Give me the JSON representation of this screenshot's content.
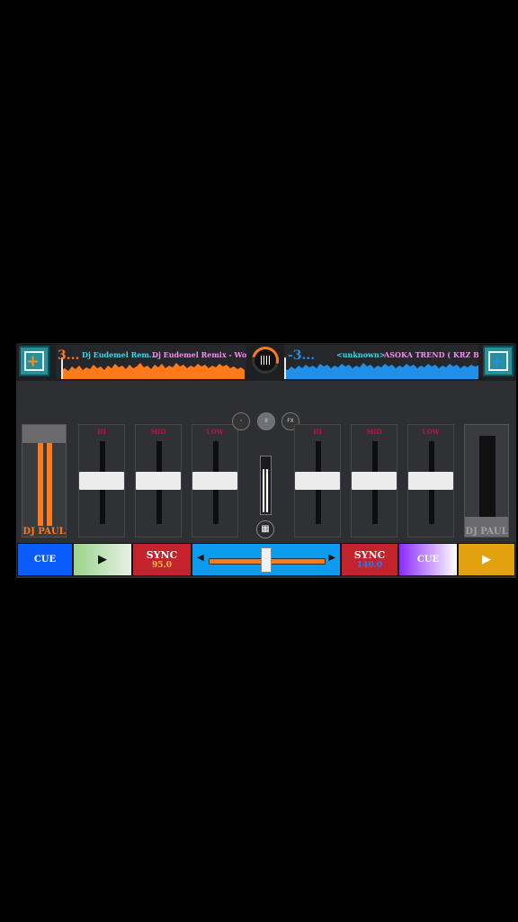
{
  "deck_left": {
    "track_number": "3...",
    "title_1": "Dj Eudemel Rem...",
    "title_2": "Dj Eudemel Remix - Wond...",
    "vu_name": "DJ PAUL",
    "vu_cap_text": "·",
    "bpm": "95.0",
    "cue_label": "CUE",
    "play_label": "▶",
    "sync_label": "SYNC",
    "color": "#ff7a1a"
  },
  "deck_right": {
    "track_number": "-3...",
    "title_1": "<unknown>",
    "title_2": "ASOKA TREND ( KRZ BUDO...",
    "vu_name": "DJ PAUL",
    "vu_cap_text": "·",
    "bpm": "140.0",
    "cue_label": "CUE",
    "play_label": "▶",
    "sync_label": "SYNC",
    "color": "#1f8fe8"
  },
  "eq_left": [
    {
      "label": "HI",
      "level": 0.5
    },
    {
      "label": "MID",
      "level": 0.5
    },
    {
      "label": "LOW",
      "level": 0.5
    }
  ],
  "eq_right": [
    {
      "label": "HI",
      "level": 0.5
    },
    {
      "label": "MID",
      "level": 0.5
    },
    {
      "label": "LOW",
      "level": 0.5
    }
  ],
  "center_buttons": [
    "◦",
    "II",
    "FX"
  ],
  "grid_icon": "▦",
  "xfader": {
    "left_arrow": "◀",
    "right_arrow": "▶",
    "position": 0.5
  },
  "icons": {
    "left_deck_button": "add-track-icon",
    "right_deck_button": "add-track-icon",
    "center_disc": "vinyl-icon"
  }
}
